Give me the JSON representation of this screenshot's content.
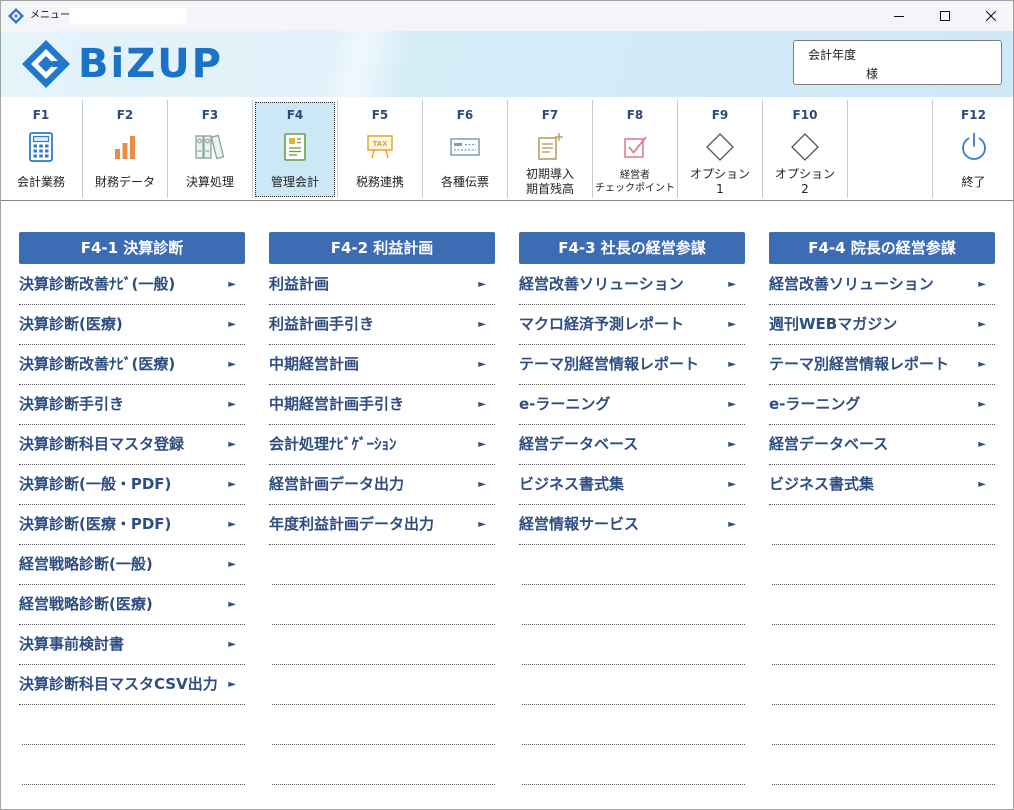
{
  "window": {
    "title": "メニュー"
  },
  "header": {
    "logo_text": "BiZUP",
    "fiscal_year_label": "会計年度",
    "customer_suffix": "様"
  },
  "toolbar": {
    "buttons": [
      {
        "key": "F1",
        "label": [
          "会計業務"
        ],
        "icon": "calculator-icon"
      },
      {
        "key": "F2",
        "label": [
          "財務データ"
        ],
        "icon": "bar-chart-icon"
      },
      {
        "key": "F3",
        "label": [
          "決算処理"
        ],
        "icon": "binders-icon"
      },
      {
        "key": "F4",
        "label": [
          "管理会計"
        ],
        "icon": "report-icon",
        "selected": true
      },
      {
        "key": "F5",
        "label": [
          "税務連携"
        ],
        "icon": "tax-sign-icon",
        "icon_text": "TAX"
      },
      {
        "key": "F6",
        "label": [
          "各種伝票"
        ],
        "icon": "slip-icon"
      },
      {
        "key": "F7",
        "label": [
          "初期導入",
          "期首残高"
        ],
        "icon": "document-add-icon"
      },
      {
        "key": "F8",
        "label": [
          "経営者",
          "チェックポイント"
        ],
        "icon": "checkbox-icon"
      },
      {
        "key": "F9",
        "label": [
          "オプション",
          "1"
        ],
        "icon": "diamond-icon"
      },
      {
        "key": "F10",
        "label": [
          "オプション",
          "2"
        ],
        "icon": "diamond-icon"
      },
      {
        "key": "F12",
        "label": [
          "終了"
        ],
        "icon": "power-icon"
      }
    ]
  },
  "menu": {
    "columns": [
      {
        "title": "F4-1 決算診断",
        "items": [
          "決算診断改善ﾅﾋﾞ(一般)",
          "決算診断(医療)",
          "決算診断改善ﾅﾋﾞ(医療)",
          "決算診断手引き",
          "決算診断科目マスタ登録",
          "決算診断(一般・PDF)",
          "決算診断(医療・PDF)",
          "経営戦略診断(一般)",
          "経営戦略診断(医療)",
          "決算事前検討書",
          "決算診断科目マスタCSV出力"
        ]
      },
      {
        "title": "F4-2 利益計画",
        "items": [
          "利益計画",
          "利益計画手引き",
          "中期経営計画",
          "中期経営計画手引き",
          "会計処理ﾅﾋﾞｹﾞｰｼｮﾝ",
          "経営計画データ出力",
          "年度利益計画データ出力"
        ]
      },
      {
        "title": "F4-3 社長の経営参謀",
        "items": [
          "経営改善ソリューション",
          "マクロ経済予測レポート",
          "テーマ別経営情報レポート",
          "e-ラーニング",
          "経営データベース",
          "ビジネス書式集",
          "経営情報サービス"
        ]
      },
      {
        "title": "F4-4 院長の経営参謀",
        "items": [
          "経営改善ソリューション",
          "週刊WEBマガジン",
          "テーマ別経営情報レポート",
          "e-ラーニング",
          "経営データベース",
          "ビジネス書式集"
        ]
      }
    ]
  },
  "colors": {
    "accent": "#3c6cb4",
    "item_text": "#2e4d80",
    "logo": "#1b73c7",
    "selected_bg": "#cce8f6"
  }
}
